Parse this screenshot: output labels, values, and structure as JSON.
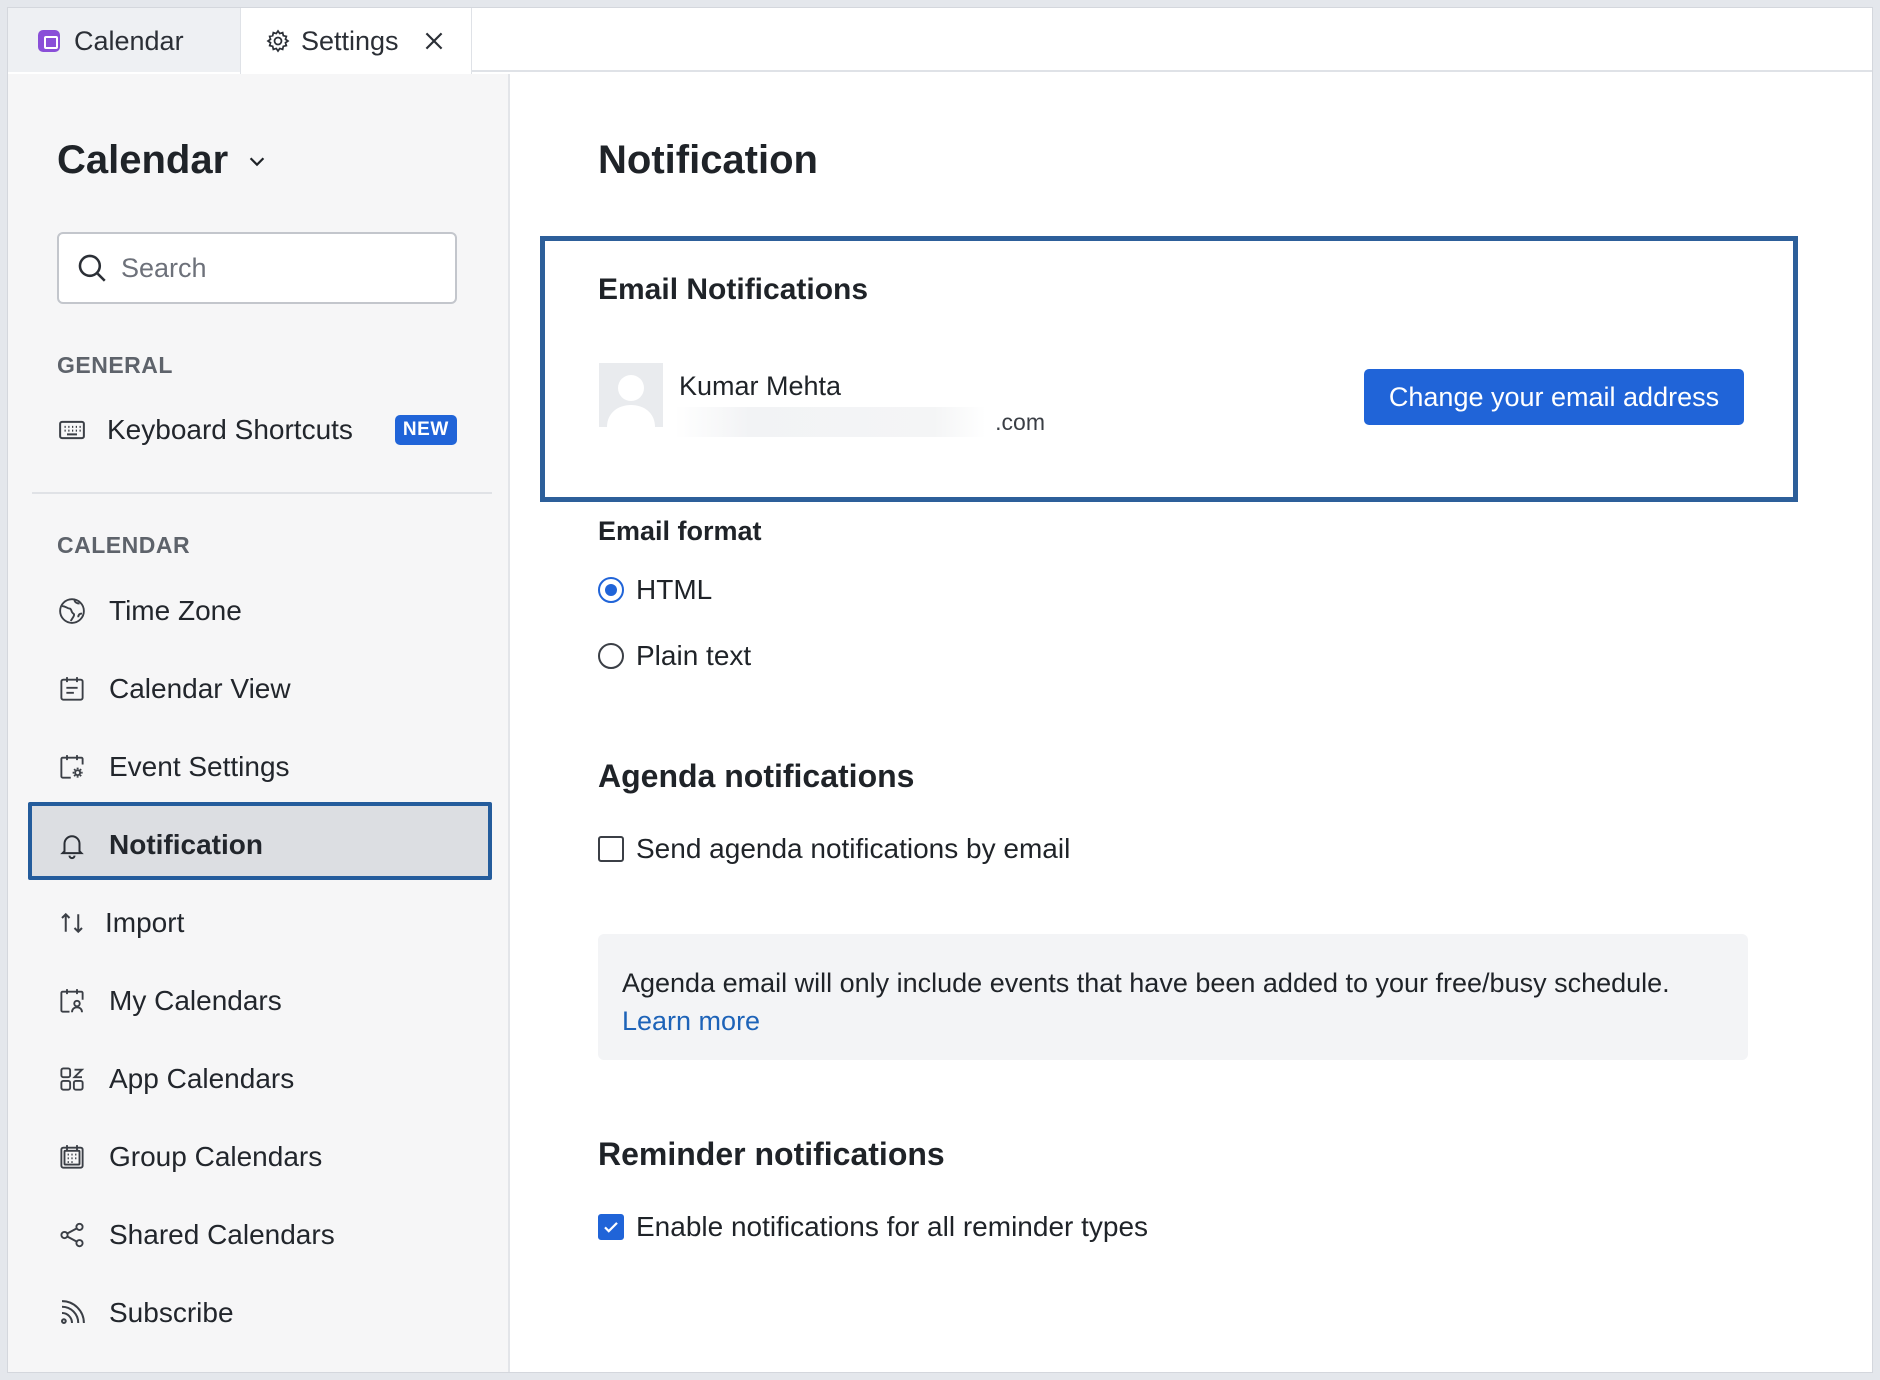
{
  "tabs": [
    {
      "label": "Calendar"
    },
    {
      "label": "Settings"
    }
  ],
  "sidebar": {
    "title": "Calendar",
    "search_placeholder": "Search",
    "general_heading": "GENERAL",
    "keyboard_shortcuts": {
      "label": "Keyboard Shortcuts",
      "badge": "NEW"
    },
    "calendar_heading": "CALENDAR",
    "items": [
      {
        "label": "Time Zone",
        "icon": "globe-icon"
      },
      {
        "label": "Calendar View",
        "icon": "calendar-view-icon"
      },
      {
        "label": "Event Settings",
        "icon": "event-settings-icon"
      },
      {
        "label": "Notification",
        "icon": "bell-icon",
        "active": true
      },
      {
        "label": "Import",
        "icon": "import-arrows-icon"
      },
      {
        "label": "My Calendars",
        "icon": "my-calendars-icon"
      },
      {
        "label": "App Calendars",
        "icon": "apps-grid-icon"
      },
      {
        "label": "Group Calendars",
        "icon": "group-calendar-icon"
      },
      {
        "label": "Shared Calendars",
        "icon": "share-icon"
      },
      {
        "label": "Subscribe",
        "icon": "rss-icon"
      }
    ]
  },
  "main": {
    "title": "Notification",
    "email_notifications": {
      "heading": "Email Notifications",
      "user_name": "Kumar Mehta",
      "email_suffix": ".com",
      "change_button": "Change your email address"
    },
    "email_format": {
      "label": "Email format",
      "options": [
        {
          "label": "HTML",
          "selected": true
        },
        {
          "label": "Plain text",
          "selected": false
        }
      ]
    },
    "agenda": {
      "heading": "Agenda notifications",
      "checkbox_label": "Send agenda notifications by email",
      "checked": false,
      "info_text": "Agenda email will only include events that have been added to your free/busy schedule.",
      "learn_more": "Learn more"
    },
    "reminder": {
      "heading": "Reminder notifications",
      "checkbox_label": "Enable notifications for all reminder types",
      "checked": true
    }
  },
  "colors": {
    "accent": "#2064d8",
    "highlight_border": "#2d5f9a",
    "app_icon": "#8a4fd8",
    "link": "#1d63b8"
  }
}
